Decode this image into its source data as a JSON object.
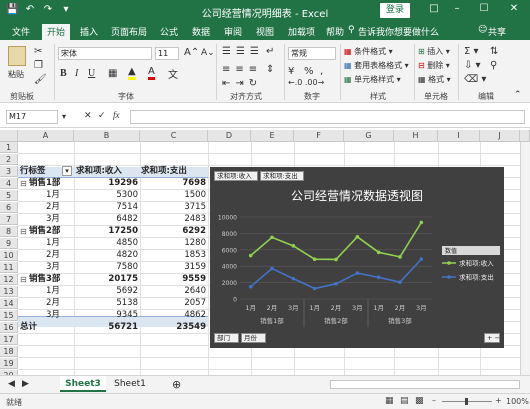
{
  "window": {
    "title": "公司经营情况明细表 - Excel",
    "login": "登录"
  },
  "menu": {
    "tabs": [
      "文件",
      "开始",
      "插入",
      "页面布局",
      "公式",
      "数据",
      "审阅",
      "视图",
      "加载项",
      "帮助"
    ],
    "active": "开始",
    "tell_me": "告诉我你想要做什么",
    "share": "共享"
  },
  "ribbon": {
    "clipboard": {
      "paste": "粘贴",
      "label": "剪贴板"
    },
    "font": {
      "name": "宋体",
      "size": "11",
      "label": "字体"
    },
    "alignment": {
      "label": "对齐方式"
    },
    "number": {
      "format": "常规",
      "label": "数字",
      "percent": "%"
    },
    "styles": {
      "conditional": "条件格式",
      "table": "套用表格格式",
      "cell": "单元格样式",
      "label": "样式"
    },
    "cells": {
      "insert": "插入",
      "delete": "删除",
      "format": "格式",
      "label": "单元格"
    },
    "editing": {
      "label": "编辑"
    }
  },
  "formula": {
    "name_box": "M17",
    "value": ""
  },
  "columns": [
    "A",
    "B",
    "C",
    "D",
    "E",
    "F",
    "G",
    "H",
    "I",
    "J"
  ],
  "rows": [
    "1",
    "2",
    "3",
    "4",
    "5",
    "6",
    "7",
    "8",
    "9",
    "10",
    "11",
    "12",
    "13",
    "14",
    "15",
    "16",
    "17",
    "18",
    "19",
    "20"
  ],
  "pivot": {
    "headers": [
      "行标签",
      "求和项:收入",
      "求和项:支出"
    ],
    "groups": [
      {
        "name": "销售1部",
        "income": "19296",
        "expense": "7698",
        "months": [
          {
            "m": "1月",
            "i": "5300",
            "e": "1500"
          },
          {
            "m": "2月",
            "i": "7514",
            "e": "3715"
          },
          {
            "m": "3月",
            "i": "6482",
            "e": "2483"
          }
        ]
      },
      {
        "name": "销售2部",
        "income": "17250",
        "expense": "6292",
        "months": [
          {
            "m": "1月",
            "i": "4850",
            "e": "1280"
          },
          {
            "m": "2月",
            "i": "4820",
            "e": "1853"
          },
          {
            "m": "3月",
            "i": "7580",
            "e": "3159"
          }
        ]
      },
      {
        "name": "销售3部",
        "income": "20175",
        "expense": "9559",
        "months": [
          {
            "m": "1月",
            "i": "5692",
            "e": "2640"
          },
          {
            "m": "2月",
            "i": "5138",
            "e": "2057"
          },
          {
            "m": "3月",
            "i": "9345",
            "e": "4862"
          }
        ]
      }
    ],
    "total": {
      "label": "总计",
      "income": "56721",
      "expense": "23549"
    }
  },
  "chart_data": {
    "type": "line",
    "title": "公司经营情况数据透视图",
    "value_buttons": [
      "求和项:收入",
      "求和项:支出"
    ],
    "axis_buttons": [
      "部门",
      "月份"
    ],
    "legend_title": "数值",
    "legend_position": "right",
    "ylim": [
      0,
      10000
    ],
    "yticks": [
      "0",
      "2000",
      "4000",
      "6000",
      "8000",
      "10000"
    ],
    "categories": [
      "1月",
      "2月",
      "3月",
      "1月",
      "2月",
      "3月",
      "1月",
      "2月",
      "3月"
    ],
    "groups": [
      "销售1部",
      "销售2部",
      "销售3部"
    ],
    "series": [
      {
        "name": "求和项:收入",
        "color": "#92d050",
        "values": [
          5300,
          7514,
          6482,
          4850,
          4820,
          7580,
          5692,
          5138,
          9345
        ]
      },
      {
        "name": "求和项:支出",
        "color": "#4472c4",
        "values": [
          1500,
          3715,
          2483,
          1280,
          1853,
          3159,
          2640,
          2057,
          4862
        ]
      }
    ]
  },
  "sheets": {
    "tabs": [
      "Sheet3",
      "Sheet1"
    ],
    "active": "Sheet3"
  },
  "status": {
    "left": "就绪",
    "zoom": "100%"
  }
}
